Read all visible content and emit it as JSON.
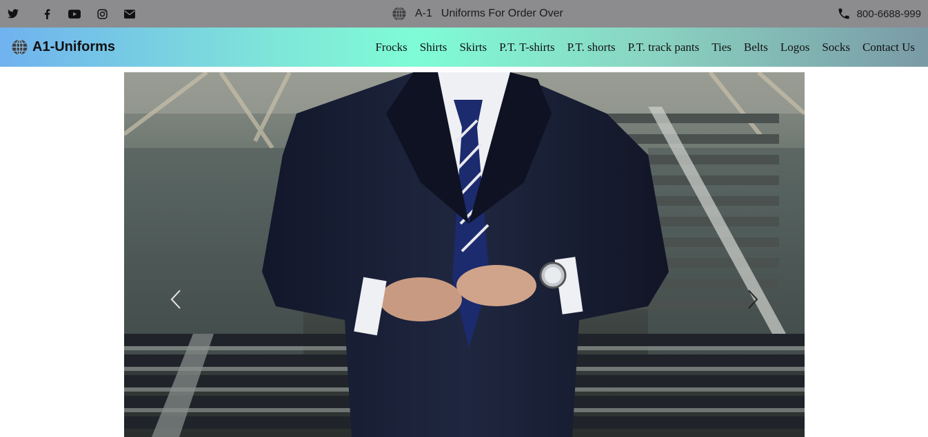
{
  "topbar": {
    "social_icons": [
      "twitter-icon",
      "facebook-icon",
      "youtube-icon",
      "instagram-icon",
      "envelope-icon"
    ],
    "brand_short": "A-1",
    "tagline": "Uniforms For Order Over",
    "phone": "800-6688-999"
  },
  "navbar": {
    "brand": "A1-Uniforms",
    "items": [
      {
        "label": "Frocks"
      },
      {
        "label": "Shirts"
      },
      {
        "label": "Skirts"
      },
      {
        "label": "P.T. T-shirts"
      },
      {
        "label": "P.T. shorts"
      },
      {
        "label": "P.T. track pants"
      },
      {
        "label": "Ties"
      },
      {
        "label": "Belts"
      },
      {
        "label": "Logos"
      },
      {
        "label": "Socks"
      },
      {
        "label": "Contact Us"
      }
    ]
  },
  "carousel": {
    "prev_icon": "chevron-left-icon",
    "next_icon": "chevron-right-icon"
  },
  "colors": {
    "topbar_bg": "#8c8c8f",
    "nav_gradient_start": "#6fb2ef",
    "nav_gradient_mid": "#7ffcd6",
    "nav_gradient_end": "#7a9aa6",
    "suit": "#1b2136"
  }
}
